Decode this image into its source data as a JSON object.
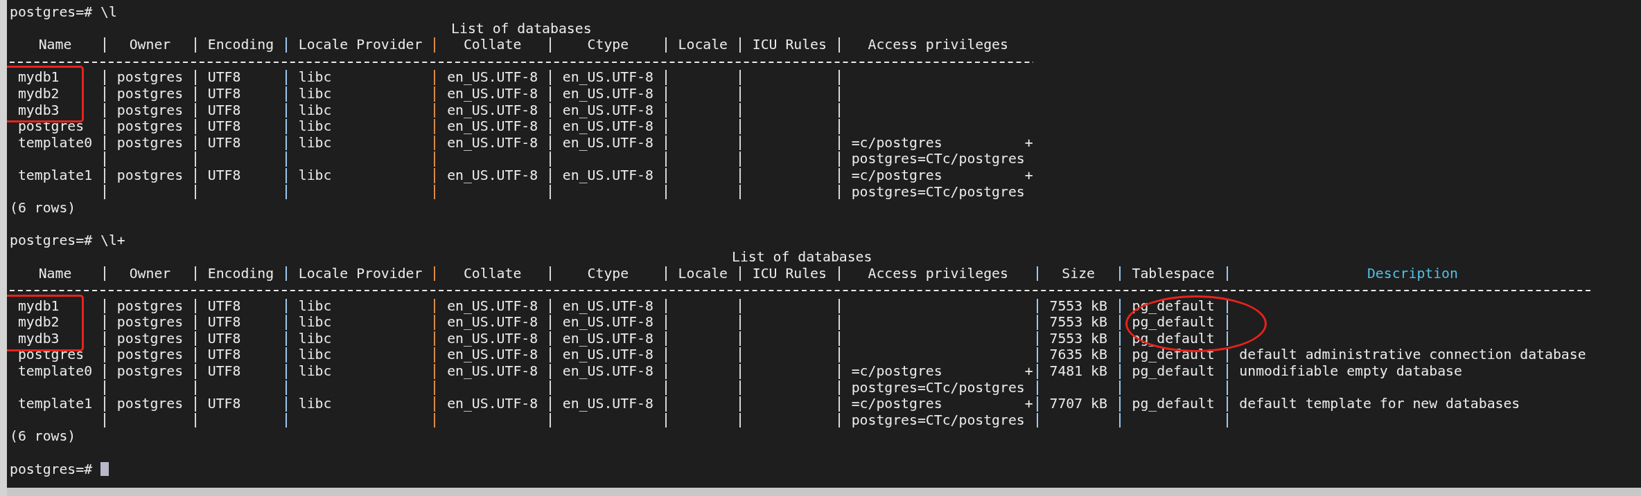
{
  "sessions": [
    {
      "prompt": "postgres=#",
      "command": "\\l",
      "table": {
        "title": "List of databases",
        "columns": [
          {
            "label": "Name",
            "highlight": {
              "kind": "rectangle"
            }
          },
          {
            "label": "Owner"
          },
          {
            "label": "Encoding"
          },
          {
            "label": "Locale Provider"
          },
          {
            "label": "Collate"
          },
          {
            "label": "Ctype"
          },
          {
            "label": "Locale"
          },
          {
            "label": "ICU Rules"
          },
          {
            "label": "Access privileges"
          }
        ],
        "rows": [
          {
            "marked": true,
            "cells": [
              "mydb1",
              "postgres",
              "UTF8",
              "libc",
              "en_US.UTF-8",
              "en_US.UTF-8"
            ]
          },
          {
            "marked": true,
            "cells": [
              "mydb2",
              "postgres",
              "UTF8",
              "libc",
              "en_US.UTF-8",
              "en_US.UTF-8"
            ]
          },
          {
            "marked": true,
            "cells": [
              "mydb3",
              "postgres",
              "UTF8",
              "libc",
              "en_US.UTF-8",
              "en_US.UTF-8"
            ]
          },
          {
            "marked": false,
            "cells": [
              "postgres",
              "postgres",
              "UTF8",
              "libc",
              "en_US.UTF-8",
              "en_US.UTF-8"
            ]
          },
          {
            "marked": false,
            "cells": [
              "template0",
              "postgres",
              "UTF8",
              "libc",
              "en_US.UTF-8",
              "en_US.UTF-8",
              null,
              null,
              {
                "lines": [
                  "=c/postgres",
                  "postgres=CTc/postgres"
                ],
                "wrap_mark": "+"
              }
            ]
          },
          {
            "marked": false,
            "cells": [
              "template1",
              "postgres",
              "UTF8",
              "libc",
              "en_US.UTF-8",
              "en_US.UTF-8",
              null,
              null,
              {
                "lines": [
                  "=c/postgres",
                  "postgres=CTc/postgres"
                ],
                "wrap_mark": "+"
              }
            ]
          }
        ],
        "footer": "(6 rows)"
      }
    },
    {
      "prompt": "postgres=#",
      "command": "\\l+",
      "table": {
        "title": "List of databases",
        "columns": [
          {
            "label": "Name",
            "highlight": {
              "kind": "rectangle"
            }
          },
          {
            "label": "Owner"
          },
          {
            "label": "Encoding"
          },
          {
            "label": "Locale Provider"
          },
          {
            "label": "Collate"
          },
          {
            "label": "Ctype"
          },
          {
            "label": "Locale"
          },
          {
            "label": "ICU Rules"
          },
          {
            "label": "Access privileges"
          },
          {
            "label": "Size"
          },
          {
            "label": "Tablespace",
            "highlight": {
              "kind": "ellipse"
            }
          },
          {
            "label": "Description",
            "color": "#4fc3e8"
          }
        ],
        "rows": [
          {
            "marked": true,
            "cells": [
              "mydb1",
              "postgres",
              "UTF8",
              "libc",
              "en_US.UTF-8",
              "en_US.UTF-8",
              null,
              null,
              null,
              "7553 kB",
              "pg_default"
            ]
          },
          {
            "marked": true,
            "cells": [
              "mydb2",
              "postgres",
              "UTF8",
              "libc",
              "en_US.UTF-8",
              "en_US.UTF-8",
              null,
              null,
              null,
              "7553 kB",
              "pg_default"
            ]
          },
          {
            "marked": true,
            "cells": [
              "mydb3",
              "postgres",
              "UTF8",
              "libc",
              "en_US.UTF-8",
              "en_US.UTF-8",
              null,
              null,
              null,
              "7553 kB",
              "pg_default"
            ]
          },
          {
            "marked": false,
            "cells": [
              "postgres",
              "postgres",
              "UTF8",
              "libc",
              "en_US.UTF-8",
              "en_US.UTF-8",
              null,
              null,
              null,
              "7635 kB",
              "pg_default",
              "default administrative connection database"
            ]
          },
          {
            "marked": false,
            "cells": [
              "template0",
              "postgres",
              "UTF8",
              "libc",
              "en_US.UTF-8",
              "en_US.UTF-8",
              null,
              null,
              {
                "lines": [
                  "=c/postgres",
                  "postgres=CTc/postgres"
                ],
                "wrap_mark": "+"
              },
              "7481 kB",
              "pg_default",
              "unmodifiable empty database"
            ]
          },
          {
            "marked": false,
            "cells": [
              "template1",
              "postgres",
              "UTF8",
              "libc",
              "en_US.UTF-8",
              "en_US.UTF-8",
              null,
              null,
              {
                "lines": [
                  "=c/postgres",
                  "postgres=CTc/postgres"
                ],
                "wrap_mark": "+"
              },
              "7707 kB",
              "pg_default",
              "default template for new databases"
            ]
          }
        ],
        "footer": "(6 rows)"
      }
    }
  ],
  "final_prompt": "postgres=#"
}
